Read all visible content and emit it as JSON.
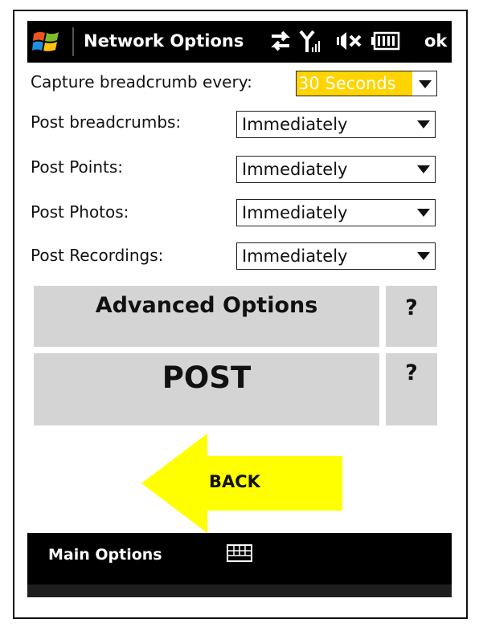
{
  "titlebar": {
    "title": "Network Options",
    "ok_label": "ok",
    "icons": [
      "windows-start-icon",
      "connectivity-arrows-icon",
      "signal-strength-icon",
      "volume-muted-icon",
      "battery-icon"
    ]
  },
  "form": {
    "capture": {
      "label": "Capture breadcrumb every:",
      "value": "30 Seconds"
    },
    "rows": [
      {
        "label": "Post breadcrumbs:",
        "value": "Immediately"
      },
      {
        "label": "Post Points:",
        "value": "Immediately"
      },
      {
        "label": "Post Photos:",
        "value": "Immediately"
      },
      {
        "label": "Post Recordings:",
        "value": "Immediately"
      }
    ]
  },
  "buttons": {
    "advanced_label": "Advanced Options",
    "advanced_help": "?",
    "post_label": "POST",
    "post_help": "?",
    "back_label": "BACK"
  },
  "bottombar": {
    "left_softkey": "Main Options",
    "center_icon": "keyboard-icon"
  },
  "colors": {
    "bar_bg": "#000000",
    "button_gray": "#d4d4d4",
    "highlight_yellow": "#ffd400",
    "arrow_yellow": "#ffff00"
  }
}
